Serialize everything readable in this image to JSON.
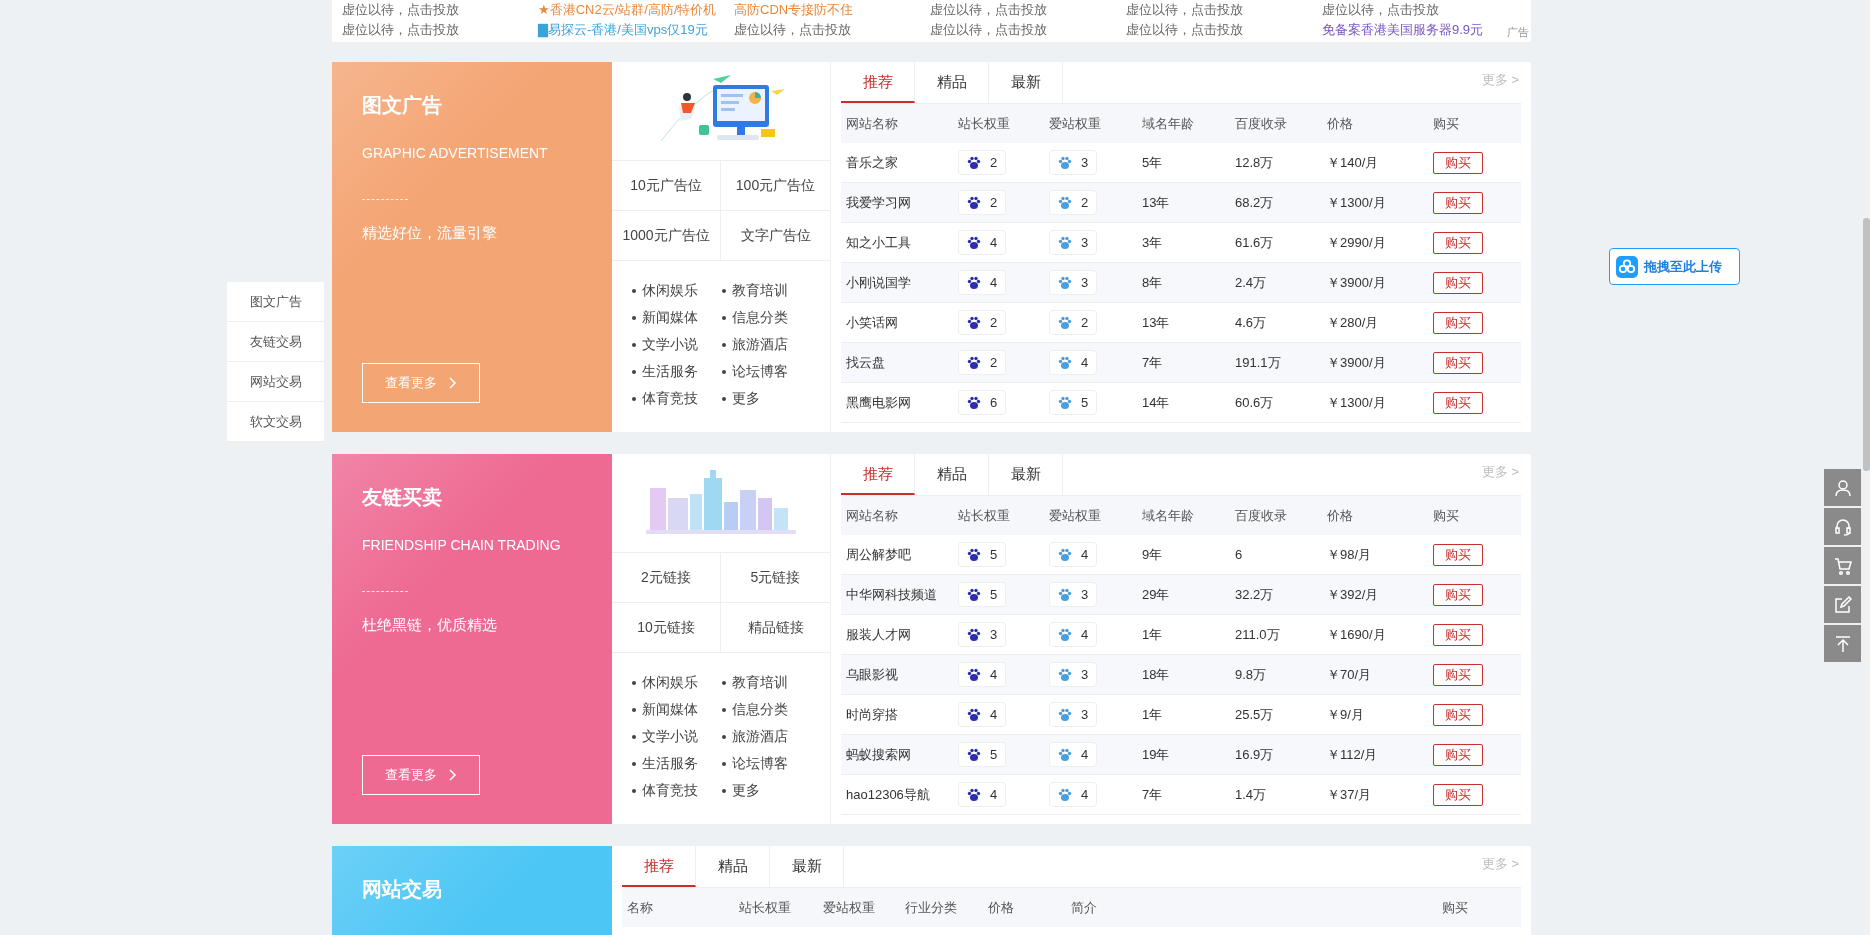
{
  "top_ads": {
    "rows": [
      [
        {
          "text": "虚位以待，点击投放",
          "color": "#666666"
        },
        {
          "text": "★香港CN2云/站群/高防/特价机",
          "color": "#e8883a"
        },
        {
          "text": "高防CDN专接防不住",
          "color": "#e8883a"
        },
        {
          "text": "虚位以待，点击投放",
          "color": "#666666"
        },
        {
          "text": "虚位以待，点击投放",
          "color": "#666666"
        },
        {
          "text": "虚位以待，点击投放",
          "color": "#666666"
        }
      ],
      [
        {
          "text": "虚位以待，点击投放",
          "color": "#666666"
        },
        {
          "text": "▇易探云-香港/美国vps仅19元",
          "color": "#3ba3dc"
        },
        {
          "text": "虚位以待，点击投放",
          "color": "#666666"
        },
        {
          "text": "虚位以待，点击投放",
          "color": "#666666"
        },
        {
          "text": "虚位以待，点击投放",
          "color": "#666666"
        },
        {
          "text": "免备案香港美国服务器9.9元",
          "color": "#7b55c0"
        }
      ]
    ],
    "label": "广告"
  },
  "side_nav": [
    {
      "label": "图文广告",
      "selected": false
    },
    {
      "label": "友链交易",
      "selected": false
    },
    {
      "label": "网站交易",
      "selected": false
    },
    {
      "label": "软文交易",
      "selected": false
    }
  ],
  "upload_button": "拖拽至此上传",
  "sections": [
    {
      "kind": "full",
      "color": "#f4a574",
      "title": "图文广告",
      "subtitle": "GRAPHIC ADVERTISEMENT",
      "slogan": "精选好位，流量引擎",
      "more_button": "查看更多",
      "illustration": {
        "kind": "computer"
      },
      "options": [
        "10元广告位",
        "100元广告位",
        "1000元广告位",
        "文字广告位"
      ],
      "categories": [
        "休闲娱乐",
        "教育培训",
        "新闻媒体",
        "信息分类",
        "文学小说",
        "旅游酒店",
        "生活服务",
        "论坛博客",
        "体育竞技",
        "更多"
      ],
      "tabs": [
        {
          "label": "推荐",
          "selected": true
        },
        {
          "label": "精品",
          "selected": false
        },
        {
          "label": "最新",
          "selected": false
        }
      ],
      "more": "更多 >",
      "columns": [
        "网站名称",
        "站长权重",
        "爱站权重",
        "域名年龄",
        "百度收录",
        "价格",
        "购买"
      ],
      "rows": [
        {
          "name": "音乐之家",
          "webmaster_weight": "2",
          "aizhan_weight": "3",
          "age": "5年",
          "indexed": "12.8万",
          "price": "￥140/月",
          "buy": "购买"
        },
        {
          "name": "我爱学习网",
          "webmaster_weight": "2",
          "aizhan_weight": "2",
          "age": "13年",
          "indexed": "68.2万",
          "price": "￥1300/月",
          "buy": "购买"
        },
        {
          "name": "知之小工具",
          "webmaster_weight": "4",
          "aizhan_weight": "3",
          "age": "3年",
          "indexed": "61.6万",
          "price": "￥2990/月",
          "buy": "购买"
        },
        {
          "name": "小刚说国学",
          "webmaster_weight": "4",
          "aizhan_weight": "3",
          "age": "8年",
          "indexed": "2.4万",
          "price": "￥3900/月",
          "buy": "购买"
        },
        {
          "name": "小笑话网",
          "webmaster_weight": "2",
          "aizhan_weight": "2",
          "age": "13年",
          "indexed": "4.6万",
          "price": "￥280/月",
          "buy": "购买"
        },
        {
          "name": "找云盘",
          "webmaster_weight": "2",
          "aizhan_weight": "4",
          "age": "7年",
          "indexed": "191.1万",
          "price": "￥3900/月",
          "buy": "购买"
        },
        {
          "name": "黑鹰电影网",
          "webmaster_weight": "6",
          "aizhan_weight": "5",
          "age": "14年",
          "indexed": "60.6万",
          "price": "￥1300/月",
          "buy": "购买"
        }
      ]
    },
    {
      "kind": "full",
      "color": "#ee6a93",
      "title": "友链买卖",
      "subtitle": "FRIENDSHIP CHAIN TRADING",
      "slogan": "杜绝黑链，优质精选",
      "more_button": "查看更多",
      "illustration": {
        "kind": "city"
      },
      "options": [
        "2元链接",
        "5元链接",
        "10元链接",
        "精品链接"
      ],
      "categories": [
        "休闲娱乐",
        "教育培训",
        "新闻媒体",
        "信息分类",
        "文学小说",
        "旅游酒店",
        "生活服务",
        "论坛博客",
        "体育竞技",
        "更多"
      ],
      "tabs": [
        {
          "label": "推荐",
          "selected": true
        },
        {
          "label": "精品",
          "selected": false
        },
        {
          "label": "最新",
          "selected": false
        }
      ],
      "more": "更多 >",
      "columns": [
        "网站名称",
        "站长权重",
        "爱站权重",
        "域名年龄",
        "百度收录",
        "价格",
        "购买"
      ],
      "rows": [
        {
          "name": "周公解梦吧",
          "webmaster_weight": "5",
          "aizhan_weight": "4",
          "age": "9年",
          "indexed": "6",
          "price": "￥98/月",
          "buy": "购买"
        },
        {
          "name": "中华网科技频道",
          "webmaster_weight": "5",
          "aizhan_weight": "3",
          "age": "29年",
          "indexed": "32.2万",
          "price": "￥392/月",
          "buy": "购买"
        },
        {
          "name": "服装人才网",
          "webmaster_weight": "3",
          "aizhan_weight": "4",
          "age": "1年",
          "indexed": "211.0万",
          "price": "￥1690/月",
          "buy": "购买"
        },
        {
          "name": "乌眼影视",
          "webmaster_weight": "4",
          "aizhan_weight": "3",
          "age": "18年",
          "indexed": "9.8万",
          "price": "￥70/月",
          "buy": "购买"
        },
        {
          "name": "时尚穿搭",
          "webmaster_weight": "4",
          "aizhan_weight": "3",
          "age": "1年",
          "indexed": "25.5万",
          "price": "￥9/月",
          "buy": "购买"
        },
        {
          "name": "蚂蚁搜索网",
          "webmaster_weight": "5",
          "aizhan_weight": "4",
          "age": "19年",
          "indexed": "16.9万",
          "price": "￥112/月",
          "buy": "购买"
        },
        {
          "name": "hao12306导航",
          "webmaster_weight": "4",
          "aizhan_weight": "4",
          "age": "7年",
          "indexed": "1.4万",
          "price": "￥37/月",
          "buy": "购买"
        }
      ]
    },
    {
      "kind": "plain",
      "color": "#4cc6f5",
      "title": "网站交易",
      "tabs": [
        {
          "label": "推荐",
          "selected": true
        },
        {
          "label": "精品",
          "selected": false
        },
        {
          "label": "最新",
          "selected": false
        }
      ],
      "more": "更多 >",
      "columns": [
        "名称",
        "站长权重",
        "爱站权重",
        "行业分类",
        "价格",
        "简介",
        "购买"
      ]
    }
  ]
}
